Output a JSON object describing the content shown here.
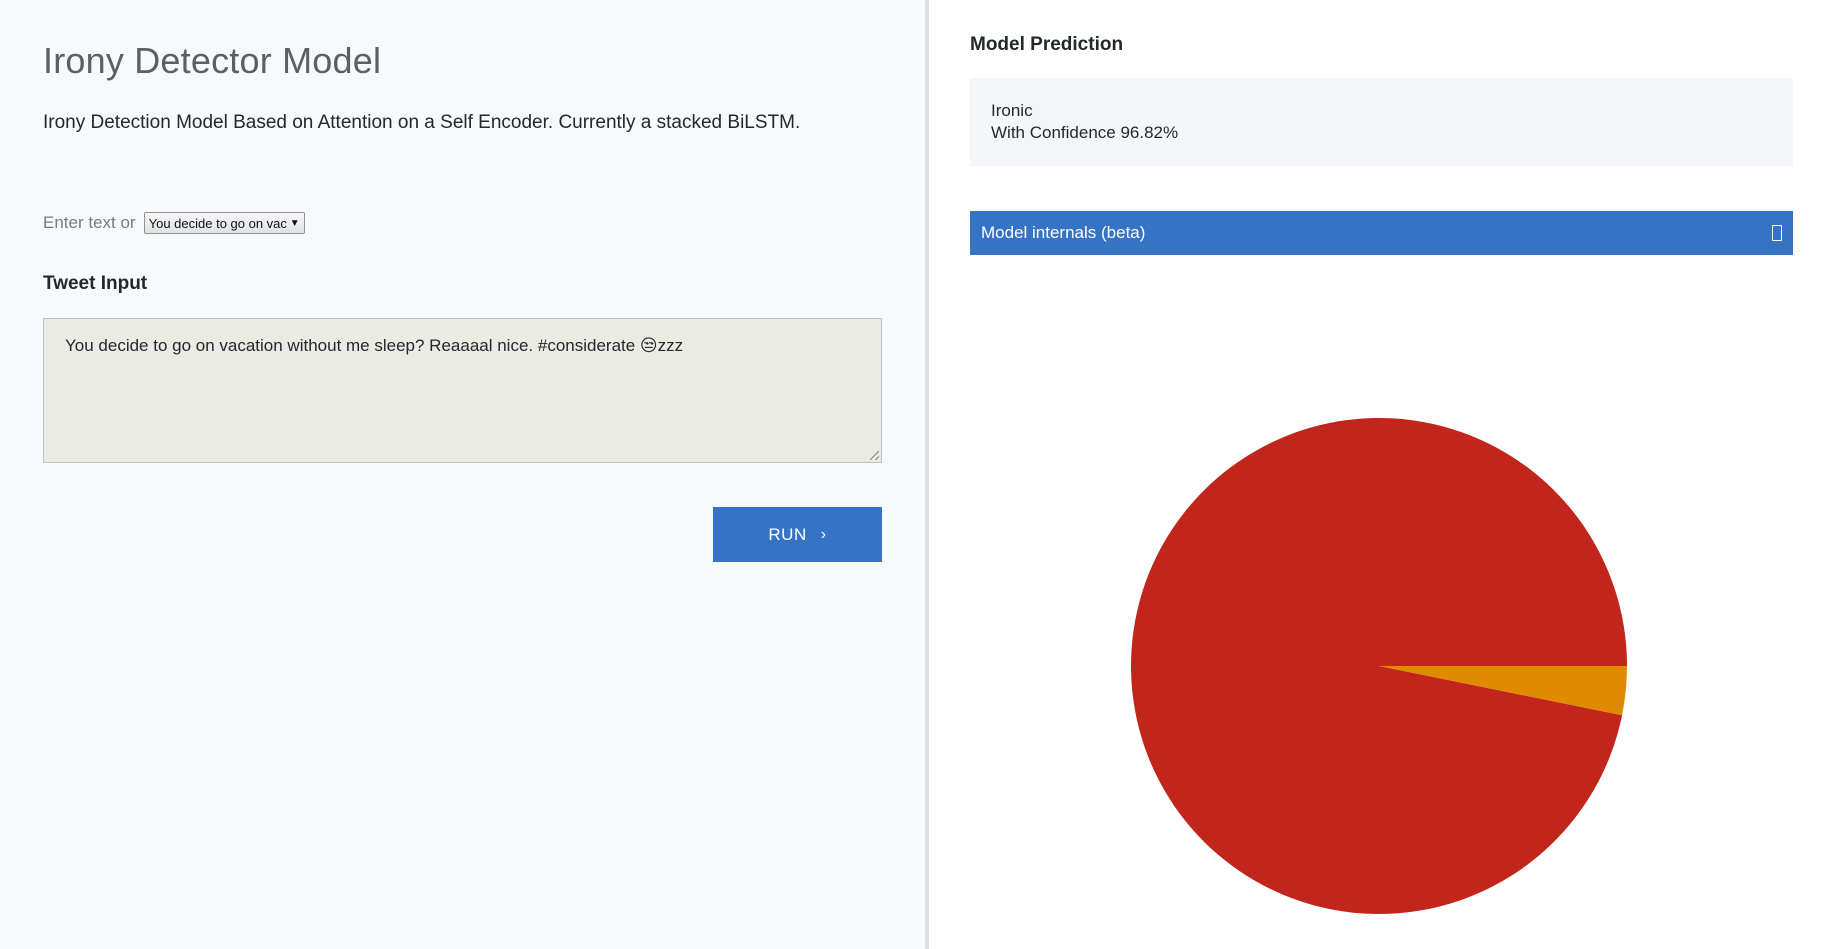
{
  "left": {
    "title": "Irony Detector Model",
    "description": "Irony Detection Model Based on Attention on a Self Encoder. Currently a stacked BiLSTM.",
    "picker_label": "Enter text or",
    "example_select_value": "You decide to go on vac",
    "input_label": "Tweet Input",
    "tweet_text": "You decide to go on vacation without me sleep? Reaaaal nice. #considerate 😒zzz",
    "run_label": "RUN",
    "run_chevron": "›"
  },
  "right": {
    "prediction_heading": "Model Prediction",
    "prediction_label": "Ironic",
    "prediction_confidence": "With Confidence 96.82%",
    "internals_label": "Model internals (beta)"
  },
  "colors": {
    "accent": "#3574c4",
    "pie_ironic": "#c2251b",
    "pie_not_ironic": "#e08a00"
  },
  "chart_data": {
    "type": "pie",
    "series": [
      {
        "value": 96.82,
        "color": "#c2251b"
      },
      {
        "value": 3.18,
        "color": "#e08a00"
      }
    ]
  }
}
